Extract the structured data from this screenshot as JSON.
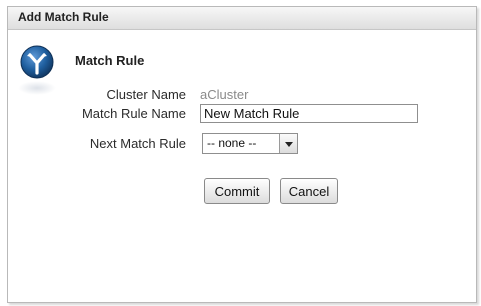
{
  "dialog": {
    "title": "Add Match Rule"
  },
  "section": {
    "title": "Match Rule",
    "icon": "match-rule-icon"
  },
  "form": {
    "cluster_name": {
      "label": "Cluster Name",
      "value": "aCluster"
    },
    "match_rule_name": {
      "label": "Match Rule Name",
      "value": "New Match Rule"
    },
    "next_match_rule": {
      "label": "Next Match Rule",
      "selected": "-- none --"
    }
  },
  "buttons": {
    "commit_label": "Commit",
    "cancel_label": "Cancel"
  },
  "colors": {
    "icon_blue": "#1f5f9f",
    "icon_light": "#ffffff",
    "value_gray": "#8a8a8a"
  }
}
